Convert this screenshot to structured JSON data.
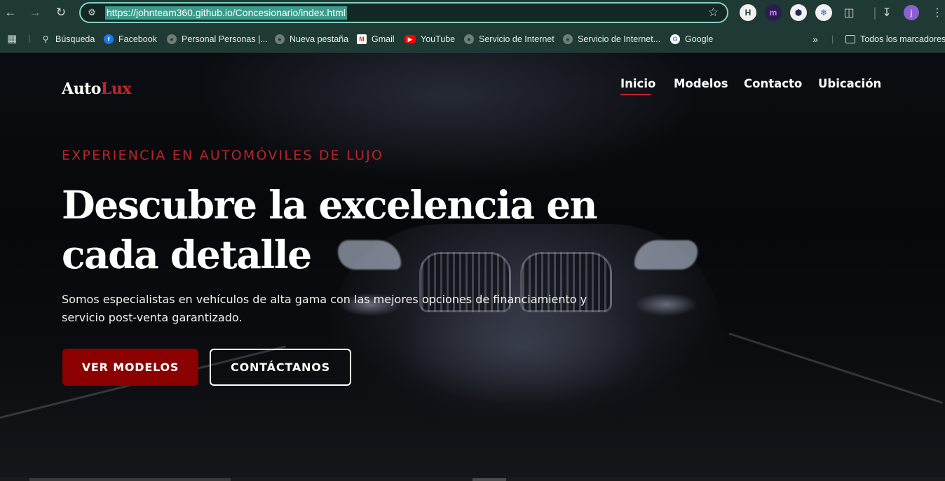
{
  "browser": {
    "url": "https://johnteam360.github.io/Concesionario/index.html",
    "profile_initial": "j"
  },
  "bookmarks": [
    {
      "label": "Búsqueda",
      "icon": "search-icon"
    },
    {
      "label": "Facebook",
      "icon": "facebook-icon"
    },
    {
      "label": "Personal Personas |...",
      "icon": "globe-icon"
    },
    {
      "label": "Nueva pestaña",
      "icon": "globe-icon"
    },
    {
      "label": "Gmail",
      "icon": "gmail-icon"
    },
    {
      "label": "YouTube",
      "icon": "youtube-icon"
    },
    {
      "label": "Servicio de Internet",
      "icon": "globe-icon"
    },
    {
      "label": "Servicio de Internet...",
      "icon": "globe-icon"
    },
    {
      "label": "Google",
      "icon": "google-icon"
    }
  ],
  "bookmarks_folder": "Todos los marcadores",
  "site": {
    "brand_main": "Auto",
    "brand_accent": "Lux",
    "nav": [
      "Inicio",
      "Modelos",
      "Contacto",
      "Ubicación"
    ],
    "active_nav": "Inicio"
  },
  "hero": {
    "eyebrow": "EXPERIENCIA EN AUTOMÓVILES DE LUJO",
    "title": "Descubre la excelencia en cada detalle",
    "text": "Somos especialistas en vehículos de alta gama con las mejores opciones de financiamiento y servicio post-venta garantizado.",
    "primary_button": "VER MODELOS",
    "secondary_button": "CONTÁCTANOS"
  },
  "colors": {
    "accent_red": "#c0262c",
    "button_red": "#8b0000",
    "chrome_green": "#1f3a34",
    "omnibox_border": "#7fd3c0"
  }
}
